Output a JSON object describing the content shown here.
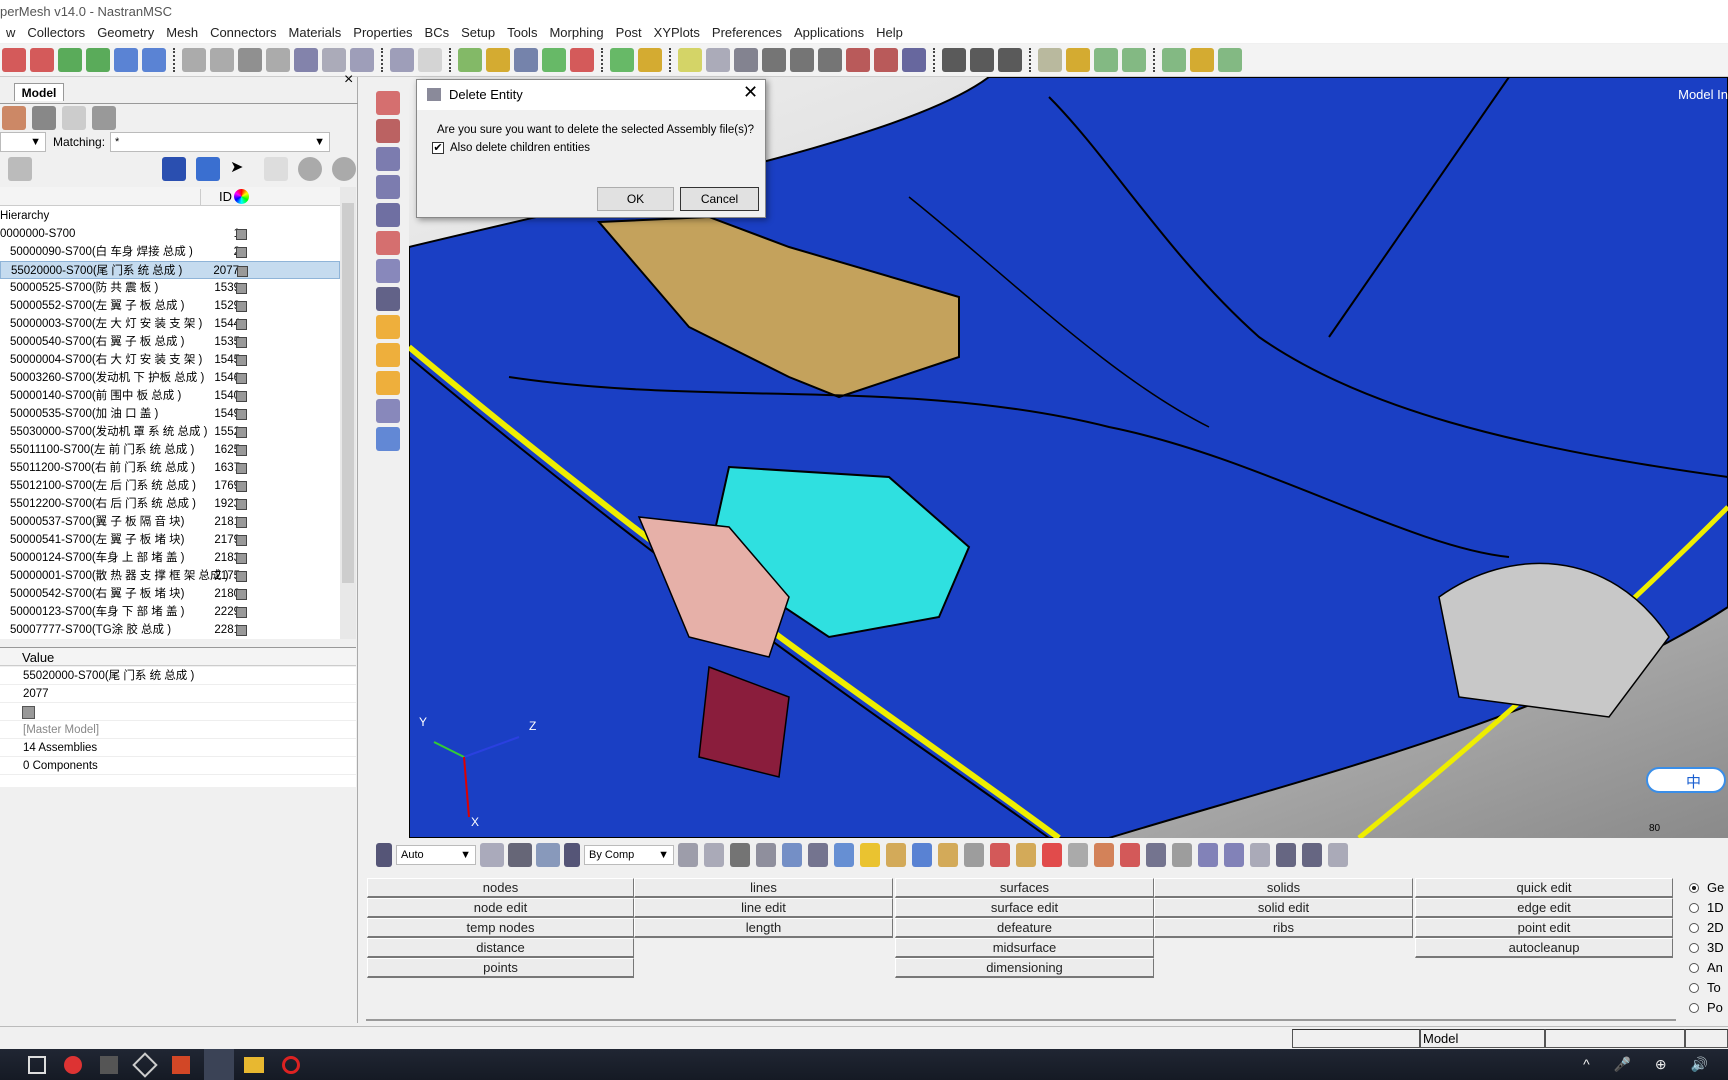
{
  "window": {
    "title": "perMesh v14.0 - NastranMSC"
  },
  "menu": [
    "w",
    "Collectors",
    "Geometry",
    "Mesh",
    "Connectors",
    "Materials",
    "Properties",
    "BCs",
    "Setup",
    "Tools",
    "Morphing",
    "Post",
    "XYPlots",
    "Preferences",
    "Applications",
    "Help"
  ],
  "left_panel": {
    "tab": "Model",
    "close": "×",
    "matching_label": "Matching:",
    "matching_value": "*",
    "tree_header": {
      "id": "ID"
    },
    "hierarchy_label": "Hierarchy",
    "rows": [
      {
        "label": "0000000-S700",
        "id": "1"
      },
      {
        "label": "50000090-S700(白 车身 焊接 总成 )",
        "id": "2"
      },
      {
        "label": "55020000-S700(尾 门系 统 总成 )",
        "id": "2077",
        "selected": true
      },
      {
        "label": "50000525-S700(防 共 震 板 )",
        "id": "1539"
      },
      {
        "label": "50000552-S700(左 翼 子 板 总成 )",
        "id": "1529"
      },
      {
        "label": "50000003-S700(左 大 灯 安 装 支 架 )",
        "id": "1544"
      },
      {
        "label": "50000540-S700(右 翼 子 板 总成 )",
        "id": "1535"
      },
      {
        "label": "50000004-S700(右 大 灯 安 装 支 架 )",
        "id": "1545"
      },
      {
        "label": "50003260-S700(发动机 下 护板 总成 )",
        "id": "1546"
      },
      {
        "label": "50000140-S700(前 围中 板 总成 )",
        "id": "1540"
      },
      {
        "label": "50000535-S700(加 油 口 盖 )",
        "id": "1549"
      },
      {
        "label": "55030000-S700(发动机 罩 系 统 总成 )",
        "id": "1552"
      },
      {
        "label": "55011100-S700(左 前 门系 统 总成 )",
        "id": "1625"
      },
      {
        "label": "55011200-S700(右 前 门系 统 总成 )",
        "id": "1637"
      },
      {
        "label": "55012100-S700(左 后 门系 统 总成 )",
        "id": "1769"
      },
      {
        "label": "55012200-S700(右 后 门系 统 总成 )",
        "id": "1923"
      },
      {
        "label": "50000537-S700(翼 子 板 隔 音 块)",
        "id": "2181"
      },
      {
        "label": "50000541-S700(左 翼 子 板 堵 块)",
        "id": "2179"
      },
      {
        "label": "50000124-S700(车身 上 部 堵 盖 )",
        "id": "2183"
      },
      {
        "label": "50000001-S700(散 热 器 支 撑 框 架 总成 )",
        "id": "2175"
      },
      {
        "label": "50000542-S700(右 翼 子 板 堵 块)",
        "id": "2180"
      },
      {
        "label": "50000123-S700(车身 下 部 堵 盖 )",
        "id": "2229"
      },
      {
        "label": "50007777-S700(TG涂 胶 总成 )",
        "id": "2281"
      }
    ],
    "props_header": "Value",
    "props": [
      "55020000-S700(尾 门系 统 总成 )",
      "2077",
      "",
      "[Master Model]",
      "14 Assemblies",
      "0 Components"
    ]
  },
  "viewport": {
    "label": "Model In",
    "scale": "80",
    "axes": {
      "x": "X",
      "y": "Y",
      "z": "Z"
    },
    "ime": "中"
  },
  "bottom_toolbar": {
    "auto": "Auto",
    "by_comp": "By Comp"
  },
  "panel": {
    "columns": [
      [
        "nodes",
        "node edit",
        "temp nodes",
        "distance",
        "points"
      ],
      [
        "lines",
        "line edit",
        "length"
      ],
      [
        "surfaces",
        "surface edit",
        "defeature",
        "midsurface",
        "dimensioning"
      ],
      [
        "solids",
        "solid edit",
        "ribs"
      ],
      [
        "quick edit",
        "edge edit",
        "point edit",
        "autocleanup"
      ]
    ],
    "radios": [
      {
        "label": "Ge",
        "checked": true
      },
      {
        "label": "1D"
      },
      {
        "label": "2D"
      },
      {
        "label": "3D"
      },
      {
        "label": "An"
      },
      {
        "label": "To"
      },
      {
        "label": "Po"
      }
    ]
  },
  "status": {
    "model": "Model"
  },
  "dialog": {
    "title": "Delete Entity",
    "message": "Are you sure you want to delete the selected Assembly file(s)?",
    "checkbox_label": "Also delete children entities",
    "checkbox_checked": true,
    "ok": "OK",
    "cancel": "Cancel"
  },
  "colors": {
    "body_blue": "#1a3fc4",
    "accent_cyan": "#2fe0e0",
    "selection": "#c5dbef"
  }
}
